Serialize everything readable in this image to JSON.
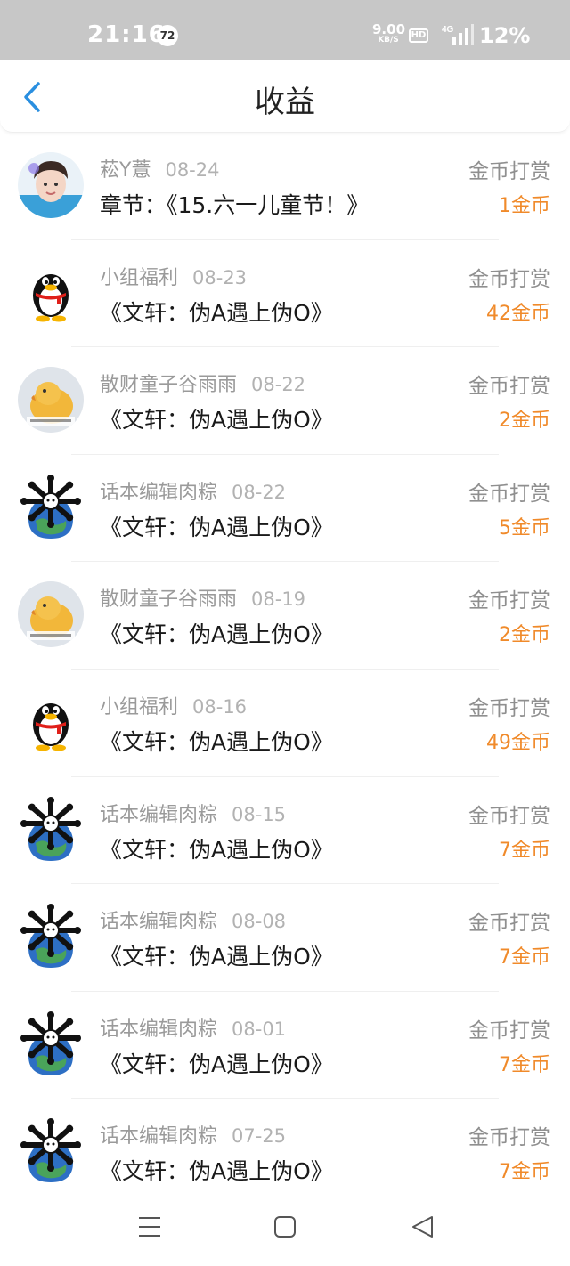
{
  "status_bar": {
    "time": "21:16",
    "badge": "72",
    "net_speed": "9.00",
    "net_unit": "KB/S",
    "hd": "HD",
    "network": "4G",
    "battery": "12%"
  },
  "header": {
    "title": "收益",
    "back_icon": "chevron-left-icon"
  },
  "rows": [
    {
      "name": "菘Y薏",
      "date": "08-24",
      "title": "章节：《15.六一儿童节！》",
      "type": "金币打赏",
      "amount": "1金币",
      "avatar": "photo"
    },
    {
      "name": "小组福利",
      "date": "08-23",
      "title": "《文轩：伪A遇上伪O》",
      "type": "金币打赏",
      "amount": "42金币",
      "avatar": "penguin"
    },
    {
      "name": "散财童子谷雨雨",
      "date": "08-22",
      "title": "《文轩：伪A遇上伪O》",
      "type": "金币打赏",
      "amount": "2金币",
      "avatar": "duck"
    },
    {
      "name": "话本编辑肉粽",
      "date": "08-22",
      "title": "《文轩：伪A遇上伪O》",
      "type": "金币打赏",
      "amount": "5金币",
      "avatar": "globe"
    },
    {
      "name": "散财童子谷雨雨",
      "date": "08-19",
      "title": "《文轩：伪A遇上伪O》",
      "type": "金币打赏",
      "amount": "2金币",
      "avatar": "duck"
    },
    {
      "name": "小组福利",
      "date": "08-16",
      "title": "《文轩：伪A遇上伪O》",
      "type": "金币打赏",
      "amount": "49金币",
      "avatar": "penguin"
    },
    {
      "name": "话本编辑肉粽",
      "date": "08-15",
      "title": "《文轩：伪A遇上伪O》",
      "type": "金币打赏",
      "amount": "7金币",
      "avatar": "globe"
    },
    {
      "name": "话本编辑肉粽",
      "date": "08-08",
      "title": "《文轩：伪A遇上伪O》",
      "type": "金币打赏",
      "amount": "7金币",
      "avatar": "globe"
    },
    {
      "name": "话本编辑肉粽",
      "date": "08-01",
      "title": "《文轩：伪A遇上伪O》",
      "type": "金币打赏",
      "amount": "7金币",
      "avatar": "globe"
    },
    {
      "name": "话本编辑肉粽",
      "date": "07-25",
      "title": "《文轩：伪A遇上伪O》",
      "type": "金币打赏",
      "amount": "7金币",
      "avatar": "globe"
    }
  ],
  "nav_bar": {
    "menu_icon": "menu-icon",
    "home_icon": "home-icon",
    "back_icon": "back-triangle-icon"
  },
  "colors": {
    "accent": "#2a8fe0",
    "amount": "#f08a2a",
    "status_bar": "#c7c7c7"
  }
}
